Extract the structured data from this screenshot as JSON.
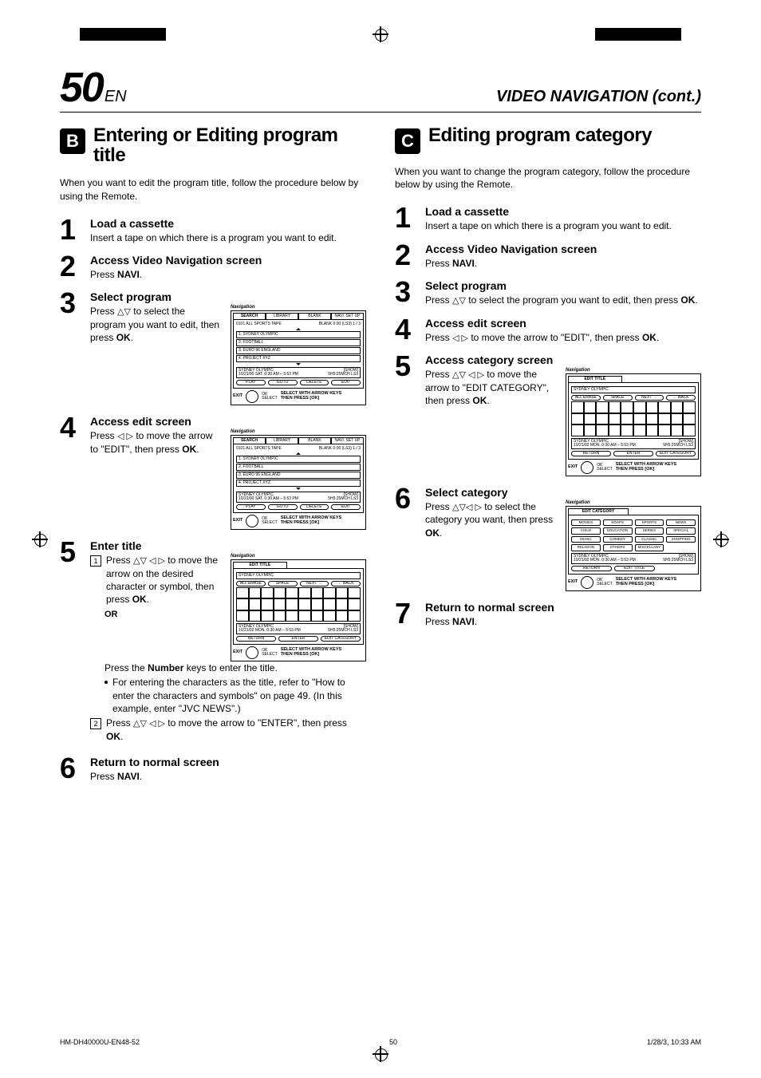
{
  "page_number": "50",
  "page_suffix": "EN",
  "header_right": "VIDEO NAVIGATION (cont.)",
  "sectionB": {
    "badge": "B",
    "title": "Entering or Editing program title",
    "intro": "When you want to edit the program title, follow the procedure below by using the Remote.",
    "steps": {
      "s1": {
        "n": "1",
        "hd": "Load a cassette",
        "txt": "Insert a tape on which there is a program you want to edit."
      },
      "s2": {
        "n": "2",
        "hd": "Access Video Navigation screen",
        "txt_pre": "Press ",
        "key": "NAVI",
        "txt_post": "."
      },
      "s3": {
        "n": "3",
        "hd": "Select program",
        "txt_pre": "Press ",
        "arrows": "△▽",
        "txt_mid": " to select the program you want to edit, then press ",
        "key": "OK",
        "txt_post": "."
      },
      "s4": {
        "n": "4",
        "hd": "Access edit screen",
        "txt_pre": "Press ",
        "arrows": "◁ ▷",
        "txt_mid": " to move the arrow to \"EDIT\", then press ",
        "key": "OK",
        "txt_post": "."
      },
      "s5": {
        "n": "5",
        "hd": "Enter title",
        "sub1_n": "1",
        "sub1_pre": "Press ",
        "sub1_arrows": "△▽ ◁ ▷",
        "sub1_mid": " to move the arrow on the desired character or symbol, then press ",
        "sub1_key": "OK",
        "sub1_post": ".",
        "or": "OR",
        "press_pre": "Press the ",
        "press_key": "Number",
        "press_post": " keys to enter the title.",
        "bullet": "For entering the characters as the title, refer to \"How to enter the characters and symbols\" on page 49. (In this example, enter \"JVC NEWS\".)",
        "sub2_n": "2",
        "sub2_pre": "Press ",
        "sub2_arrows": "△▽ ◁ ▷",
        "sub2_mid": " to move the arrow to \"ENTER\", then press ",
        "sub2_key": "OK",
        "sub2_post": "."
      },
      "s6": {
        "n": "6",
        "hd": "Return to normal screen",
        "txt_pre": "Press ",
        "key": "NAVI",
        "txt_post": "."
      }
    }
  },
  "sectionC": {
    "badge": "C",
    "title": "Editing program category",
    "intro": "When you want to change the program category, follow the procedure below by using the Remote.",
    "steps": {
      "s1": {
        "n": "1",
        "hd": "Load a cassette",
        "txt": "Insert a tape on which there is a program you want to edit."
      },
      "s2": {
        "n": "2",
        "hd": "Access Video Navigation screen",
        "txt_pre": "Press ",
        "key": "NAVI",
        "txt_post": "."
      },
      "s3": {
        "n": "3",
        "hd": "Select program",
        "txt_pre": "Press ",
        "arrows": "△▽",
        "txt_mid": " to select the program you want to edit, then press ",
        "key": "OK",
        "txt_post": "."
      },
      "s4": {
        "n": "4",
        "hd": "Access edit screen",
        "txt_pre": "Press ",
        "arrows": "◁ ▷",
        "txt_mid": " to move the arrow to \"EDIT\", then press ",
        "key": "OK",
        "txt_post": "."
      },
      "s5": {
        "n": "5",
        "hd": "Access category screen",
        "txt_pre": "Press ",
        "arrows": "△▽  ◁ ▷",
        "txt_mid": " to move the arrow to \"EDIT CATEGORY\", then press ",
        "key": "OK",
        "txt_post": "."
      },
      "s6": {
        "n": "6",
        "hd": "Select category",
        "txt_pre": "Press ",
        "arrows": "△▽◁ ▷",
        "txt_mid": " to select the category you want, then press ",
        "key": "OK",
        "txt_post": "."
      },
      "s7": {
        "n": "7",
        "hd": "Return to normal screen",
        "txt_pre": "Press ",
        "key": "NAVI",
        "txt_post": "."
      }
    }
  },
  "screens": {
    "nav_brand": "Navigation",
    "tabs": {
      "search": "SEARCH",
      "library": "LIBRARY",
      "blank": "BLANK",
      "setup": "NAVI. SET UP"
    },
    "tape_hdr_l": "0101 ALL SPORTS TAPE",
    "tape_hdr_r": "BLANK 0:00 (LS3)   1 / 3",
    "items": {
      "i1": "1. SYDNEY OLYMPIC",
      "i2": "2. FOOTBALL",
      "i3": "3. EURO 96 ENGLAND",
      "i4": "4. PROJECT XYZ"
    },
    "info_l": "SYDNEY OLYMPIC\n10/21/00 SAT. 0:30 AM – 5:53 PM",
    "info_r": "[SHOW]\n5H5:25MCH   LS3",
    "btns": {
      "play": "PLAY",
      "goto": "GOTO",
      "delete": "DELETE",
      "edit": "EDIT"
    },
    "foot_exit": "EXIT",
    "foot_ok": "OK",
    "foot_sel": "SELECT",
    "foot_msg": "SELECT WITH ARROW KEYS\nTHEN PRESS [OK]",
    "edit_title_tab": "EDIT TITLE",
    "edit_input": "SYDNEY OLYMPIC",
    "edit_btns": {
      "erase": "ALL ERASE",
      "space": "SPACE",
      "next": "NEXT →",
      "back": "← BACK"
    },
    "edit_info_l": "SYDNEY OLYMPIC\n10/21/02 MON. 0:30 AM – 5:53 PM",
    "edit_btns2": {
      "ret": "RETURN",
      "enter": "ENTER",
      "cat": "EDIT CATEGORY"
    },
    "cat_tab": "EDIT CATEGORY",
    "cats": {
      "c1": "MOVIES",
      "c2": "SOAPS",
      "c3": "SPORTS",
      "c4": "NEWS",
      "c5": "CHILD",
      "c6": "EDUCATION",
      "c7": "SERIES",
      "c8": "SPECIAL",
      "c9": "MUSIC",
      "c10": "COMEDY",
      "c11": "CLASSIC",
      "c12": "SHOPPING",
      "c13": "RELIGION",
      "c14": "OTHERS",
      "c15": "MISCELLANY"
    },
    "cat_btns": {
      "ret": "RETURN",
      "et": "EDIT TITLE"
    }
  },
  "footer": {
    "left": "HM-DH40000U-EN48-52",
    "center": "50",
    "right": "1/28/3, 10:33 AM"
  }
}
